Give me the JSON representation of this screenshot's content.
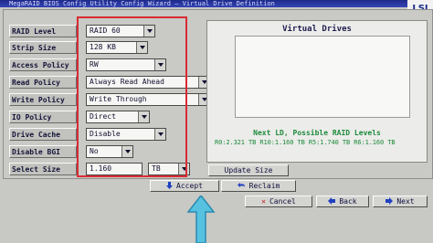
{
  "window": {
    "title": "MegaRAID BIOS Config Utility Config Wizard – Virtual Drive Definition",
    "logo": "LSI"
  },
  "form": {
    "fields": [
      {
        "key": "raid_level",
        "label": "RAID Level",
        "value": "RAID 60"
      },
      {
        "key": "strip_size",
        "label": "Strip Size",
        "value": "128 KB"
      },
      {
        "key": "access_policy",
        "label": "Access Policy",
        "value": "RW"
      },
      {
        "key": "read_policy",
        "label": "Read Policy",
        "value": "Always Read Ahead"
      },
      {
        "key": "write_policy",
        "label": "Write Policy",
        "value": "Write Through"
      },
      {
        "key": "io_policy",
        "label": "IO Policy",
        "value": "Direct"
      },
      {
        "key": "drive_cache",
        "label": "Drive Cache",
        "value": "Disable"
      },
      {
        "key": "disable_bgi",
        "label": "Disable BGI",
        "value": "No"
      },
      {
        "key": "select_size",
        "label": "Select Size",
        "value": "1.160",
        "unit": "TB"
      }
    ]
  },
  "virtual_drives": {
    "title": "Virtual Drives",
    "next_ld": "Next LD, Possible RAID Levels",
    "levels": "R0:2.321 TB  R10:1.160 TB  R5:1.740 TB  R6:1.160 TB"
  },
  "buttons": {
    "update_size": "Update Size",
    "accept": "Accept",
    "reclaim": "Reclaim",
    "cancel": "Cancel",
    "back": "Back",
    "next": "Next"
  },
  "colors": {
    "highlight_box": "#d82c34",
    "title_bar": "#2a3aa4",
    "status_text": "#1c8a3a",
    "pointer": "#56c2e0"
  }
}
